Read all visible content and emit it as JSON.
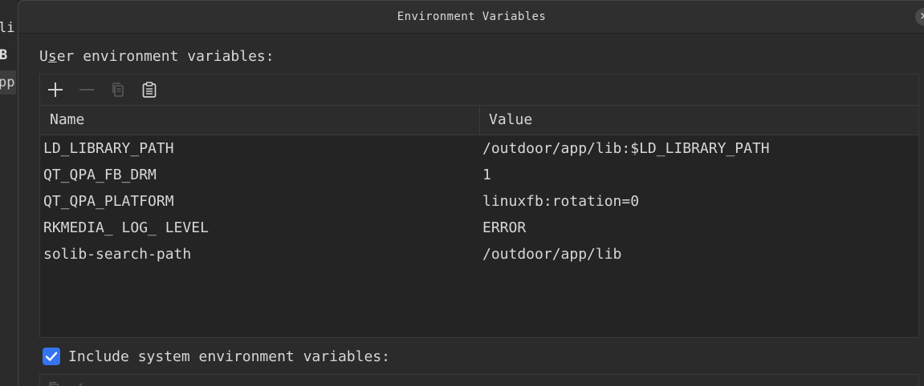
{
  "background_window": {
    "fragments": [
      "li",
      "B",
      "pp"
    ]
  },
  "dialog": {
    "title": "Environment Variables",
    "close_glyph": "×"
  },
  "user_section": {
    "label_before": "U",
    "label_mnemonic": "s",
    "label_after": "er environment variables:",
    "toolbar": {
      "add_icon": "plus-icon",
      "remove_icon": "minus-icon",
      "copy_icon": "copy-icon",
      "paste_icon": "clipboard-icon"
    },
    "columns": {
      "name": "Name",
      "value": "Value"
    },
    "rows": [
      {
        "name": "LD_LIBRARY_PATH",
        "value": "/outdoor/app/lib:$LD_LIBRARY_PATH"
      },
      {
        "name": "QT_QPA_FB_DRM",
        "value": "1"
      },
      {
        "name": "QT_QPA_PLATFORM",
        "value": "linuxfb:rotation=0"
      },
      {
        "name": "RKMEDIA_ LOG_ LEVEL",
        "value": "ERROR"
      },
      {
        "name": "solib-search-path",
        "value": "/outdoor/app/lib"
      }
    ]
  },
  "system_section": {
    "include_checked": true,
    "include_label": "Include system environment variables:"
  },
  "colors": {
    "accent": "#3574f0",
    "background": "#2b2b2b",
    "text": "#d7d7d7"
  }
}
